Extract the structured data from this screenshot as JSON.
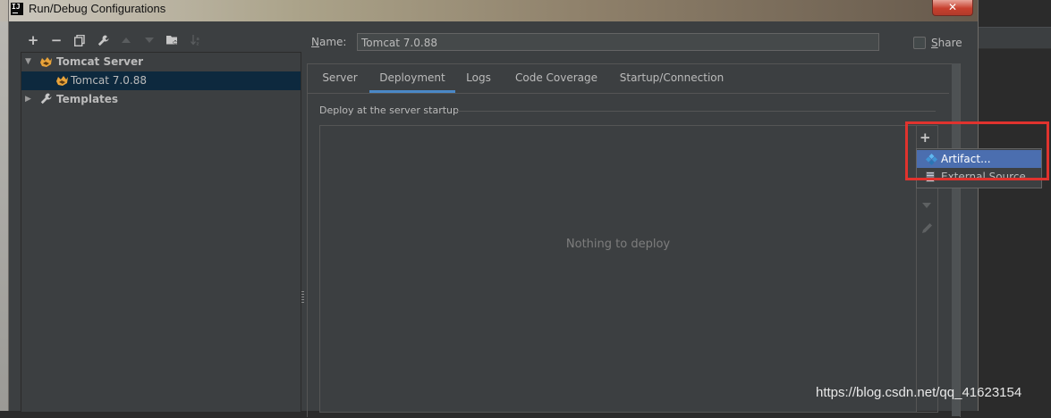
{
  "window": {
    "title": "Run/Debug Configurations",
    "app_icon_text": "IJ",
    "close_label": "✕"
  },
  "toolbar": {
    "add_label": "+",
    "remove_label": "−"
  },
  "tree": {
    "items": [
      {
        "label": "Tomcat Server",
        "icon": "tomcat-icon",
        "expanded": true
      },
      {
        "label": "Tomcat 7.0.88",
        "icon": "tomcat-icon",
        "selected": true
      },
      {
        "label": "Templates",
        "icon": "wrench-icon",
        "expanded": false
      }
    ]
  },
  "config": {
    "name_label_prefix": "N",
    "name_label_rest": "ame:",
    "name_value": "Tomcat 7.0.88",
    "share_label_prefix": "S",
    "share_label_rest": "hare",
    "share_checked": false
  },
  "tabs": [
    {
      "label": "Server"
    },
    {
      "label": "Deployment",
      "active": true
    },
    {
      "label": "Logs"
    },
    {
      "label": "Code Coverage"
    },
    {
      "label": "Startup/Connection"
    }
  ],
  "deployment": {
    "section_title": "Deploy at the server startup",
    "empty_text": "Nothing to deploy",
    "add_label": "+"
  },
  "popup": {
    "items": [
      {
        "label": "Artifact...",
        "icon": "artifact-icon",
        "selected": true
      },
      {
        "label": "External Source...",
        "icon": "external-source-icon",
        "selected": false
      }
    ]
  },
  "watermark": "https://blog.csdn.net/qq_41623154",
  "colors": {
    "selection": "#0d293e",
    "tab_underline": "#4a88c7",
    "popup_selected": "#4b6eaf",
    "highlight_box": "#e0332e"
  }
}
